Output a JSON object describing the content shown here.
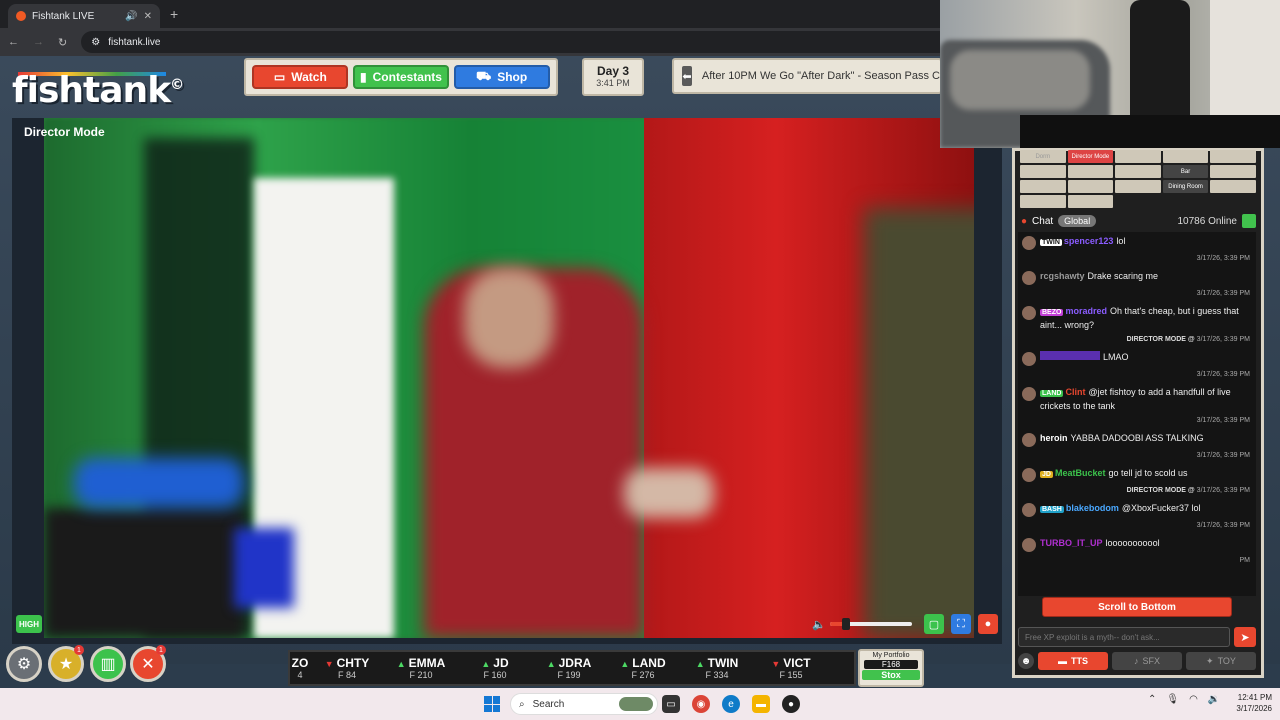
{
  "browser": {
    "tab_title": "Fishtank LIVE",
    "url": "fishtank.live",
    "new_tab": "+"
  },
  "site": {
    "logo": "fishtank",
    "logo_mark": "©",
    "nav": {
      "watch": "Watch",
      "contestants": "Contestants",
      "shop": "Shop"
    },
    "day": {
      "label": "Day 3",
      "time": "3:41 PM"
    },
    "announcement": "After 10PM We Go \"After Dark\" - Season Pass C"
  },
  "video": {
    "title": "Director Mode",
    "quality": "HIGH",
    "volume_level": 0.2
  },
  "ticker": [
    {
      "name": "ZO",
      "value": "4",
      "dir": "none"
    },
    {
      "name": "CHTY",
      "value": "F 84",
      "dir": "down"
    },
    {
      "name": "EMMA",
      "value": "F 210",
      "dir": "up"
    },
    {
      "name": "JD",
      "value": "F 160",
      "dir": "up"
    },
    {
      "name": "JDRA",
      "value": "F 199",
      "dir": "up"
    },
    {
      "name": "LAND",
      "value": "F 276",
      "dir": "up"
    },
    {
      "name": "TWIN",
      "value": "F 334",
      "dir": "up"
    },
    {
      "name": "VICT",
      "value": "F 155",
      "dir": "down"
    }
  ],
  "portfolio": {
    "label": "My Portfolio",
    "value": "F168",
    "button": "Stox"
  },
  "rooms": [
    "Dorm",
    "Director Mode",
    "",
    "",
    "",
    "",
    "",
    "",
    "Bar",
    "",
    "",
    "",
    "",
    "Dining Room",
    "",
    "",
    ""
  ],
  "chat": {
    "title": "Chat",
    "tab": "Global",
    "online": "10786 Online",
    "messages": [
      {
        "tag": "TWIN",
        "tag_color": "#ffffff",
        "user": "spencer123",
        "user_color": "#8a5cff",
        "text": "lol",
        "ts": "3/17/26, 3:39 PM",
        "dm": ""
      },
      {
        "tag": "",
        "tag_color": "",
        "user": "rcgshawty",
        "user_color": "#9a9a9a",
        "text": "Drake scaring me",
        "ts": "3/17/26, 3:39 PM",
        "dm": ""
      },
      {
        "tag": "BEZO",
        "tag_color": "#c43fd8",
        "user": "moradred",
        "user_color": "#8a5cff",
        "text": "Oh that's cheap, but i guess that aint... wrong?",
        "ts": "3/17/26, 3:39 PM",
        "dm": "DIRECTOR MODE @ "
      },
      {
        "tag": "",
        "tag_color": "",
        "user": "",
        "user_color": "#5a2fb0",
        "text": "LMAO",
        "ts": "3/17/26, 3:39 PM",
        "dm": ""
      },
      {
        "tag": "LAND",
        "tag_color": "#3cc24c",
        "user": "Clint",
        "user_color": "#e8472f",
        "text": "@jet fishtoy to add a handfull of live crickets to the tank",
        "ts": "3/17/26, 3:39 PM",
        "dm": ""
      },
      {
        "tag": "",
        "tag_color": "",
        "user": "heroin",
        "user_color": "#ffffff",
        "text": "YABBA DADOOBI ASS TALKING",
        "ts": "3/17/26, 3:39 PM",
        "dm": ""
      },
      {
        "tag": "JD",
        "tag_color": "#e0b020",
        "user": "MeatBucket",
        "user_color": "#3cc24c",
        "text": "go tell jd to scold us",
        "ts": "3/17/26, 3:39 PM",
        "dm": "DIRECTOR MODE @ "
      },
      {
        "tag": "BASH",
        "tag_color": "#1fa0c8",
        "user": "blakebodom",
        "user_color": "#4aa8ff",
        "text": "@XboxFucker37 lol",
        "ts": "3/17/26, 3:39 PM",
        "dm": ""
      },
      {
        "tag": "",
        "tag_color": "",
        "user": "TURBO_IT_UP",
        "user_color": "#b030d0",
        "text": "looooooooool",
        "ts": "PM",
        "dm": ""
      }
    ],
    "scroll_button": "Scroll to Bottom",
    "input_placeholder": "Free XP exploit is a myth-- don't ask...",
    "tts": "TTS",
    "sfx": "SFX",
    "toy": "TOY"
  },
  "taskbar": {
    "search": "Search",
    "time": "12:41 PM",
    "date": "3/17/2026"
  },
  "colors": {
    "accent_red": "#e8472f",
    "accent_green": "#41c24d",
    "accent_blue": "#2f7be0"
  }
}
